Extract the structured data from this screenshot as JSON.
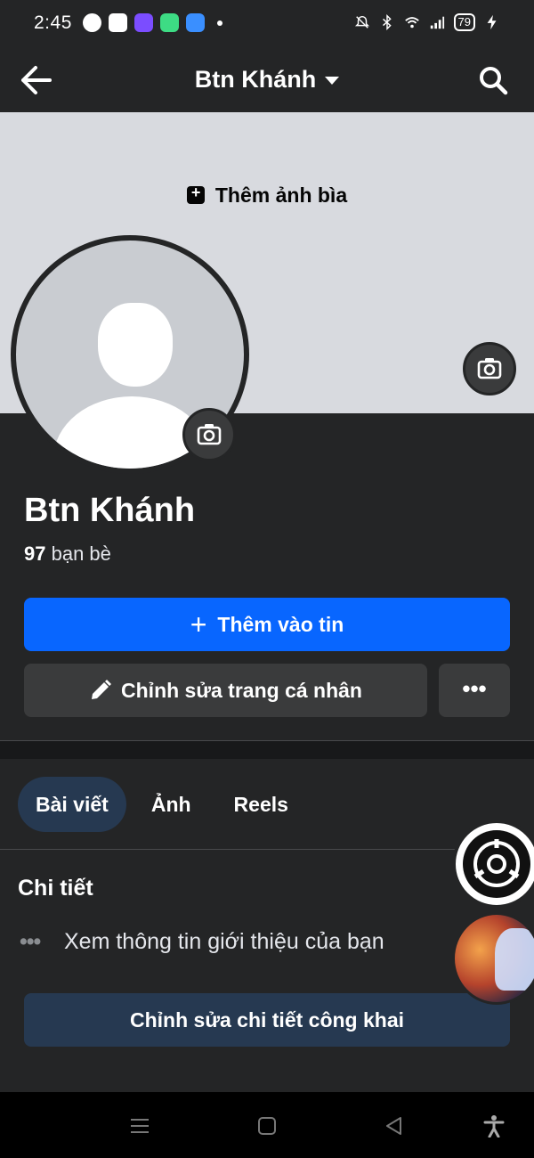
{
  "status_bar": {
    "time": "2:45",
    "battery": "79"
  },
  "header": {
    "title": "Btn Khánh"
  },
  "cover": {
    "add_cover_label": "Thêm ảnh bìa"
  },
  "profile": {
    "name": "Btn Khánh",
    "friends_count": "97",
    "friends_label": "bạn bè"
  },
  "actions": {
    "add_story_label": "Thêm vào tin",
    "edit_profile_label": "Chỉnh sửa trang cá nhân",
    "more_label": "•••"
  },
  "tabs": [
    {
      "label": "Bài viết",
      "active": true
    },
    {
      "label": "Ảnh",
      "active": false
    },
    {
      "label": "Reels",
      "active": false
    }
  ],
  "details": {
    "title": "Chi tiết",
    "intro_text": "Xem thông tin giới thiệu của bạn",
    "edit_public_label": "Chỉnh sửa chi tiết công khai"
  },
  "colors": {
    "primary": "#0866ff",
    "secondary_button": "#3a3b3c",
    "tab_active": "#263951",
    "background": "#242526"
  },
  "icons": [
    "back-arrow-icon",
    "caret-down-icon",
    "search-icon",
    "add-photo-icon",
    "camera-icon",
    "plus-icon",
    "pencil-icon",
    "more-dots-icon"
  ]
}
